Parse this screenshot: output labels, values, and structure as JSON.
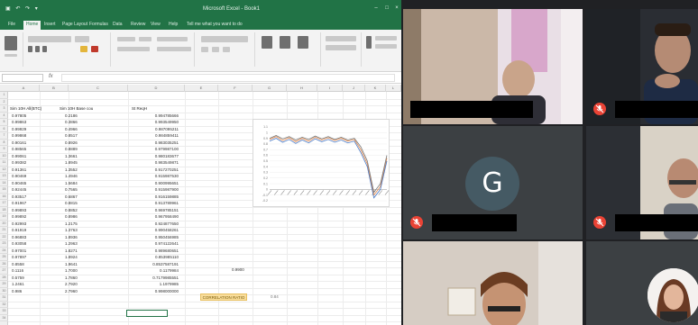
{
  "excel": {
    "title": "Microsoft Excel - Book1",
    "ribbon_tabs": [
      "File",
      "Home",
      "Insert",
      "Page Layout",
      "Formulas",
      "Data",
      "Review",
      "View",
      "Help",
      "Tell me what you want to do"
    ],
    "active_tab": "Home",
    "name_box": "",
    "formula": "",
    "columns": [
      "A",
      "B",
      "C",
      "D",
      "E",
      "F",
      "G",
      "H",
      "I",
      "J",
      "K",
      "L"
    ],
    "headers": {
      "col_a": "Sim 10H All(BTC)",
      "col_b": "Sim 10H Base cou",
      "col_c": "St ReqH"
    },
    "rows": [
      {
        "a": "0.97805",
        "b": "0.2186",
        "c": "0.994785666"
      },
      {
        "a": "0.99863",
        "b": "0.3866",
        "c": "0.993549950"
      },
      {
        "a": "0.99929",
        "b": "0.4966",
        "c": "0.987095211"
      },
      {
        "a": "0.99868",
        "b": "0.8517",
        "c": "0.984859411"
      },
      {
        "a": "0.90161",
        "b": "0.8926",
        "c": "0.983035251"
      },
      {
        "a": "0.98565",
        "b": "0.8889",
        "c": "0.979987100"
      },
      {
        "a": "0.99061",
        "b": "1.3661",
        "c": "0.980183677"
      },
      {
        "a": "0.99382",
        "b": "1.8945",
        "c": "0.983549871"
      },
      {
        "a": "0.91361",
        "b": "1.3552",
        "c": "0.917270251"
      },
      {
        "a": "0.90469",
        "b": "1.4946",
        "c": "0.915987530"
      },
      {
        "a": "0.90465",
        "b": "1.5684",
        "c": "0.900995651"
      },
      {
        "a": "0.92445",
        "b": "0.7565",
        "c": "0.915987900"
      },
      {
        "a": "0.93517",
        "b": "0.6867",
        "c": "0.916159885"
      },
      {
        "a": "0.91967",
        "b": "0.8815",
        "c": "0.913789961"
      },
      {
        "a": "0.99893",
        "b": "0.8852",
        "c": "0.969785151"
      },
      {
        "a": "0.99892",
        "b": "0.8986",
        "c": "0.967958490"
      },
      {
        "a": "0.92993",
        "b": "1.2175",
        "c": "0.924877650"
      },
      {
        "a": "0.91919",
        "b": "1.3763",
        "c": "0.990458261"
      },
      {
        "a": "0.96883",
        "b": "1.8936",
        "c": "0.950456985"
      },
      {
        "a": "0.93058",
        "b": "1.2963",
        "c": "0.974122641"
      },
      {
        "a": "0.97001",
        "b": "1.8271",
        "c": "0.989680651"
      },
      {
        "a": "0.97897",
        "b": "1.8924",
        "c": "0.853985110"
      },
      {
        "a": "0.8558",
        "b": "1.9641",
        "c": "0.8537587191"
      },
      {
        "a": "0.1116",
        "b": "1.7000",
        "c": "0.1179984"
      },
      {
        "a": "0.5759",
        "b": "1.7860",
        "c": "0.7179985551"
      },
      {
        "a": "1.2461",
        "b": "2.7920",
        "c": "1.1979985"
      },
      {
        "a": "0.986",
        "b": "2.7960",
        "c": "0.998000000"
      }
    ],
    "loose_value": "0.9900",
    "highlight_label": "CORRELATION RATIO",
    "highlight_value": "0.84"
  },
  "meet": {
    "tile_g_initial": "G"
  },
  "chart_data": {
    "type": "line",
    "ylim": [
      -0.2,
      1.1
    ],
    "yticks": [
      "1.1",
      "1",
      "0.9",
      "0.8",
      "0.7",
      "0.6",
      "0.5",
      "0.4",
      "0.3",
      "0.2",
      "0.1",
      "0",
      "-0.1",
      "-0.2"
    ],
    "series": [
      {
        "values": [
          0.88,
          0.93,
          0.86,
          0.91,
          0.84,
          0.9,
          0.85,
          0.92,
          0.87,
          0.91,
          0.86,
          0.9,
          0.85,
          0.88,
          0.7,
          0.45,
          -0.1,
          0.05,
          0.55
        ]
      },
      {
        "values": [
          0.9,
          0.95,
          0.89,
          0.93,
          0.87,
          0.92,
          0.88,
          0.94,
          0.89,
          0.93,
          0.88,
          0.92,
          0.87,
          0.9,
          0.75,
          0.5,
          -0.05,
          0.1,
          0.6
        ]
      },
      {
        "values": [
          0.85,
          0.9,
          0.83,
          0.88,
          0.81,
          0.87,
          0.82,
          0.89,
          0.84,
          0.88,
          0.83,
          0.87,
          0.82,
          0.85,
          0.65,
          0.4,
          -0.15,
          0.0,
          0.5
        ]
      }
    ],
    "colors": [
      "#e0864a",
      "#7a7a7a",
      "#4a7bc8"
    ]
  }
}
